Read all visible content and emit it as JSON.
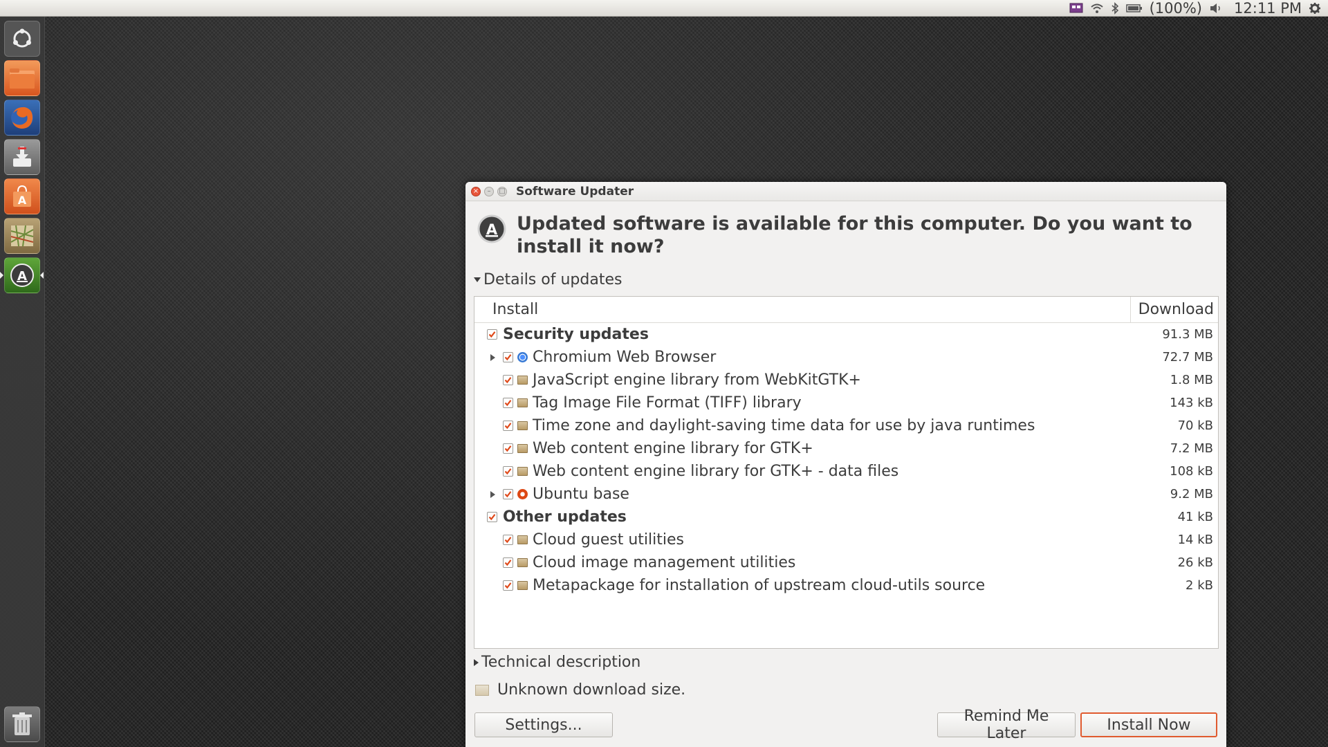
{
  "topbar": {
    "battery_text": "(100%)",
    "clock": "12:11 PM"
  },
  "launcher": {
    "items": [
      {
        "name": "dash-home",
        "color": "#6b6b6b"
      },
      {
        "name": "files",
        "color": "#e3682c"
      },
      {
        "name": "firefox",
        "color": "#e0592a"
      },
      {
        "name": "installer",
        "color": "#8a8a8a"
      },
      {
        "name": "software-center",
        "color": "#e06b2c"
      },
      {
        "name": "maps",
        "color": "#8d7a54"
      },
      {
        "name": "software-updater",
        "color": "#4c8a2e"
      },
      {
        "name": "trash",
        "color": "#8a8a8a"
      }
    ]
  },
  "window": {
    "title": "Software Updater",
    "headline": "Updated software is available for this computer. Do you want to install it now?",
    "details_label": "Details of updates",
    "columns": {
      "install": "Install",
      "download": "Download"
    },
    "rows": [
      {
        "type": "group",
        "label": "Security updates",
        "size": "91.3 MB"
      },
      {
        "type": "item",
        "label": "Chromium Web Browser",
        "size": "72.7 MB",
        "expandable": true,
        "icon": "chromium-icon"
      },
      {
        "type": "item",
        "label": "JavaScript engine library from WebKitGTK+",
        "size": "1.8 MB",
        "icon": "package-icon"
      },
      {
        "type": "item",
        "label": "Tag Image File Format (TIFF) library",
        "size": "143 kB",
        "icon": "package-icon"
      },
      {
        "type": "item",
        "label": "Time zone and daylight-saving time data for use by java runtimes",
        "size": "70 kB",
        "icon": "package-icon"
      },
      {
        "type": "item",
        "label": "Web content engine library for GTK+",
        "size": "7.2 MB",
        "icon": "package-icon"
      },
      {
        "type": "item",
        "label": "Web content engine library for GTK+ - data files",
        "size": "108 kB",
        "icon": "package-icon"
      },
      {
        "type": "item",
        "label": "Ubuntu base",
        "size": "9.2 MB",
        "expandable": true,
        "icon": "ubuntu-icon"
      },
      {
        "type": "group",
        "label": "Other updates",
        "size": "41 kB"
      },
      {
        "type": "item",
        "label": "Cloud guest utilities",
        "size": "14 kB",
        "icon": "package-icon"
      },
      {
        "type": "item",
        "label": "Cloud image management utilities",
        "size": "26 kB",
        "icon": "package-icon"
      },
      {
        "type": "item",
        "label": "Metapackage for installation of upstream cloud-utils source",
        "size": "2 kB",
        "icon": "package-icon"
      }
    ],
    "technical_label": "Technical description",
    "download_size_text": "Unknown download size.",
    "buttons": {
      "settings": "Settings...",
      "remind": "Remind Me Later",
      "install": "Install Now"
    },
    "accent_color": "#e05a2f"
  }
}
